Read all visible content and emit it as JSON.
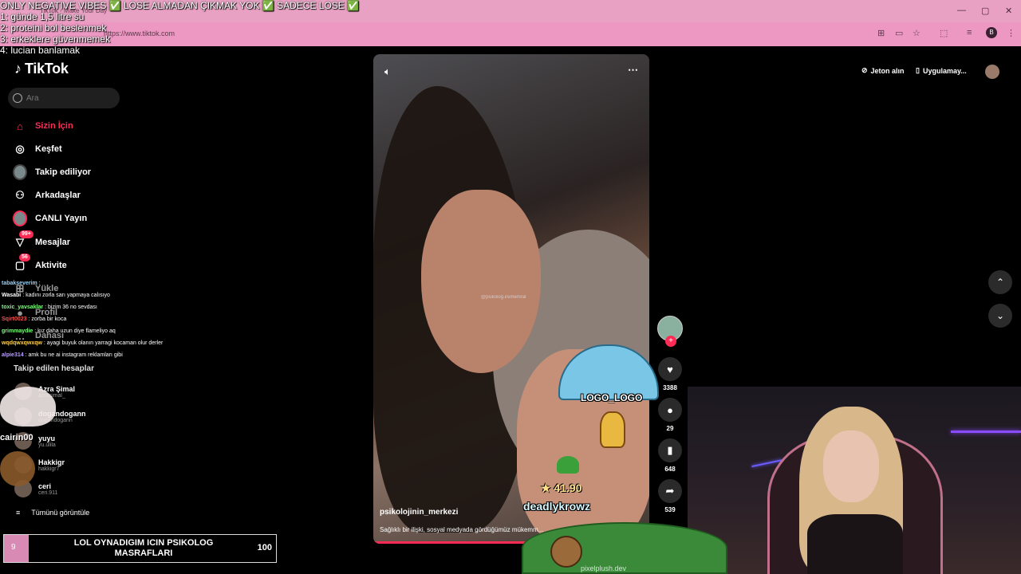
{
  "browser": {
    "tab_title": "TikTok - Make Your Day",
    "url": "https://www.tiktok.com",
    "profile_letter": "B"
  },
  "overlay": {
    "lines": [
      "ONLY NEGATIVE VIBES ✅ LOSE ALMADAN ÇIKMAK YOK ✅ SADECE LOSE ✅",
      "1: günde 1,5 litre su",
      "2: proteini bol beslenmek",
      "3: erkeklere güvenmemek",
      "4: lucian banlamak"
    ]
  },
  "sidebar": {
    "logo": "TikTok",
    "search_placeholder": "Ara",
    "nav": [
      {
        "label": "Sizin İçin"
      },
      {
        "label": "Keşfet"
      },
      {
        "label": "Takip ediliyor"
      },
      {
        "label": "Arkadaşlar"
      },
      {
        "label": "CANLI Yayın"
      },
      {
        "label": "Mesajlar",
        "badge": "99+"
      },
      {
        "label": "Aktivite",
        "badge": "56"
      },
      {
        "label": "Yükle"
      },
      {
        "label": "Profil"
      },
      {
        "label": "Dahası"
      }
    ],
    "following_header": "Takip edilen hesaplar",
    "accounts": [
      {
        "name": "Azra Şimal",
        "handle": "azrasimal_"
      },
      {
        "name": "dogandogann",
        "handle": "dogandogann"
      },
      {
        "name": "yuyu",
        "handle": "yu.ulila"
      },
      {
        "name": "Hakkigr",
        "handle": "hakkigr7"
      },
      {
        "name": "ceri",
        "handle": "ceri.911"
      }
    ],
    "see_all": "Tümünü görüntüle"
  },
  "chat": [
    {
      "user": "tabakseverim",
      "msg": ":",
      "color": "#8fd3ff"
    },
    {
      "user": "Wasabi",
      "msg": ": kadını zorla sarı yapmaya calısıyo",
      "color": "#ffffff"
    },
    {
      "user": "toxic_yavsaklar",
      "msg": ": bizim 36 no sevdası",
      "color": "#7dff7d"
    },
    {
      "user": "Sqirt0023",
      "msg": ": zorba bir koca",
      "color": "#ff4d4d"
    },
    {
      "user": "grimmaydie",
      "msg": ": kız daha uzun diye flameliyo aq",
      "color": "#7dff7d"
    },
    {
      "user": "wqdqwxqwxqw",
      "msg": ": ayagi buyuk olanın yarragi kocaman olur derler",
      "color": "#ffd24d"
    },
    {
      "user": "alpie314",
      "msg": ": amk bu ne ai instagram reklamları gibi",
      "color": "#b8a0ff"
    }
  ],
  "video": {
    "watermark": "@psikolog.irememral",
    "author": "psikolojinin_merkezi",
    "caption": "Sağlıklı bir ilişki, sosyal medyada gördüğümüz mükemm...",
    "progress": 0.62
  },
  "actions": {
    "likes": "3388",
    "comments": "29",
    "saves": "648",
    "shares": "539"
  },
  "topbar": {
    "coins": "Jeton alın",
    "app": "Uygulamay..."
  },
  "game": {
    "parachute_label": "LOGO_LOGO",
    "score": "41.90",
    "player": "deadlykrowz",
    "bush_label": "pixelplush.dev",
    "left_sprite_name": "cairin00"
  },
  "goal": {
    "start": "9",
    "title": "LOL OYNADIGIM ICIN PSIKOLOG MASRAFLARI",
    "end": "100",
    "fill_fraction": 0.09
  },
  "colors": {
    "accent": "#fe2c55",
    "chrome": "#ec98c2"
  }
}
